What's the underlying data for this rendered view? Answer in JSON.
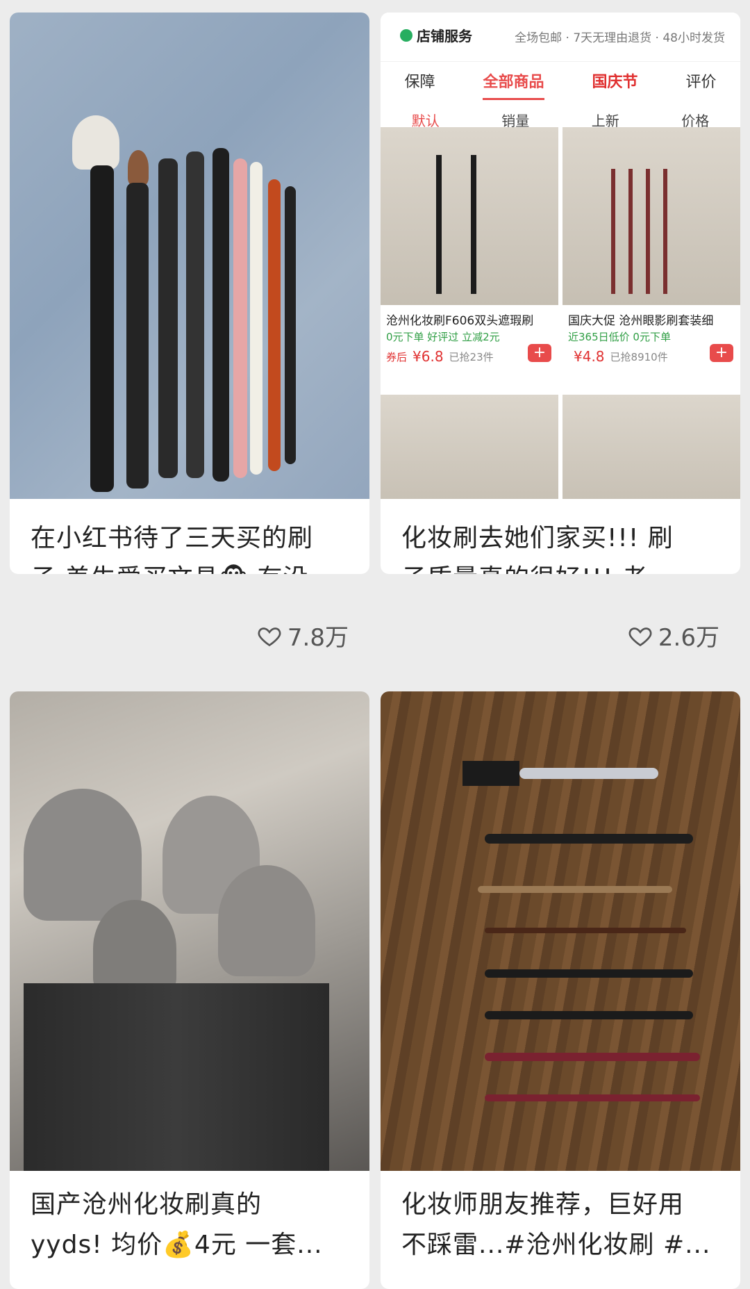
{
  "cards": [
    {
      "title": "在小红书待了三天买的刷\n子 差生爱买文具🐵 有没...",
      "likes": "7.8万"
    },
    {
      "title": "化妆刷去她们家买!!! 刷\n子质量真的很好!!! 老...",
      "likes": "2.6万",
      "shop": {
        "service_label": "店铺服务",
        "service_desc": "全场包邮 · 7天无理由退货 · 48小时发货",
        "tabs": [
          "保障",
          "全部商品",
          "国庆节",
          "评价"
        ],
        "sorts": [
          "默认",
          "销量",
          "上新",
          "价格"
        ],
        "products": [
          {
            "name": "沧州化妆刷F606双头遮瑕刷",
            "tags": "0元下单  好评过  立减2元",
            "price_prefix": "券后",
            "price": "¥6.8",
            "sold": "已抢23件"
          },
          {
            "name": "国庆大促 沧州眼影刷套装细",
            "tags": "近365日低价  0元下单",
            "price_prefix": "",
            "price": "¥4.8",
            "sold": "已抢8910件"
          }
        ]
      }
    },
    {
      "title": "国产沧州化妆刷真的\nyyds! 均价💰4元 一套..."
    },
    {
      "title": "化妆师朋友推荐，巨好用\n不踩雷...#沧州化妆刷 #..."
    }
  ],
  "colors": {
    "accent": "#e84b4b",
    "green": "#27ae60"
  }
}
